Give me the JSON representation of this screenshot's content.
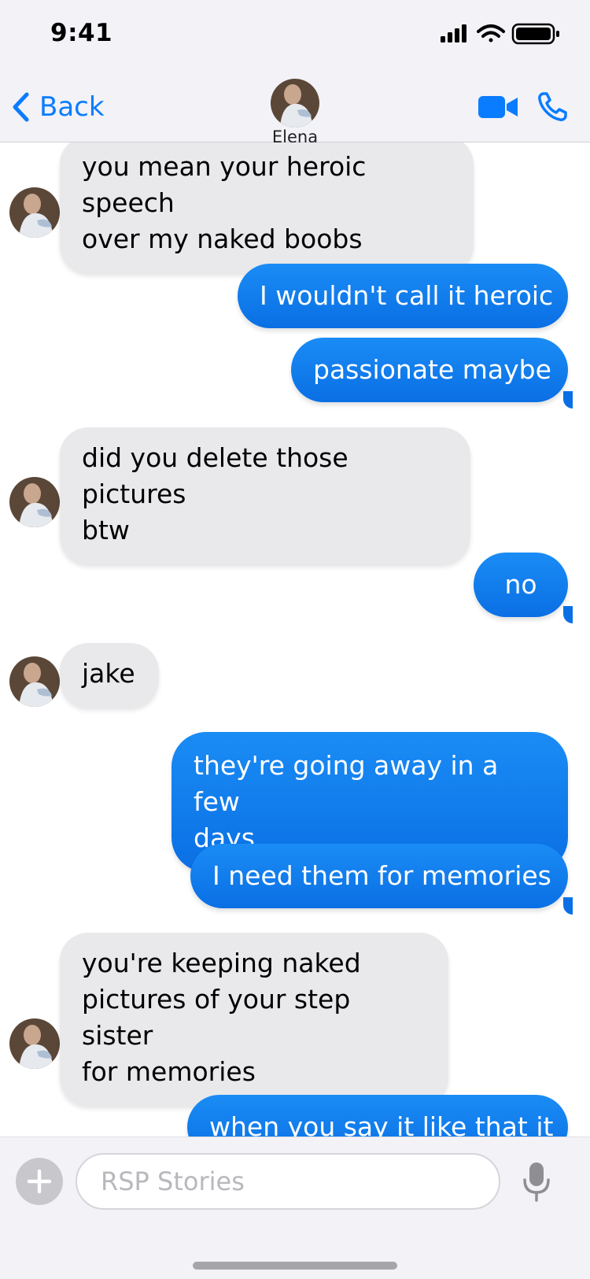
{
  "status_bar": {
    "time": "9:41"
  },
  "header": {
    "back_label": "Back",
    "contact_name": "Elena"
  },
  "messages": [
    {
      "from": "them",
      "lines": [
        "you mean your heroic speech",
        "over my naked boobs"
      ]
    },
    {
      "from": "me",
      "text": "I wouldn't call it heroic"
    },
    {
      "from": "me",
      "text": "passionate maybe"
    },
    {
      "from": "them",
      "lines": [
        "did you delete those pictures",
        "btw"
      ]
    },
    {
      "from": "me",
      "text": "no"
    },
    {
      "from": "them",
      "lines": [
        "jake"
      ]
    },
    {
      "from": "me",
      "lines": [
        "they're going away in a few",
        "days"
      ]
    },
    {
      "from": "me",
      "text": "I need them for memories"
    },
    {
      "from": "them",
      "lines": [
        "you're keeping naked",
        "pictures of your step sister",
        "for memories"
      ]
    },
    {
      "from": "me",
      "text": "when you say it like that it"
    }
  ],
  "composer": {
    "placeholder": "RSP Stories",
    "value": ""
  },
  "colors": {
    "accent": "#0a7cff",
    "outgoing_bubble": "#0a6fe4",
    "incoming_bubble": "#e9e9eb"
  },
  "icons": [
    "signal-icon",
    "wifi-icon",
    "battery-icon",
    "chevron-left-icon",
    "video-camera-icon",
    "phone-icon",
    "plus-icon",
    "microphone-icon"
  ]
}
